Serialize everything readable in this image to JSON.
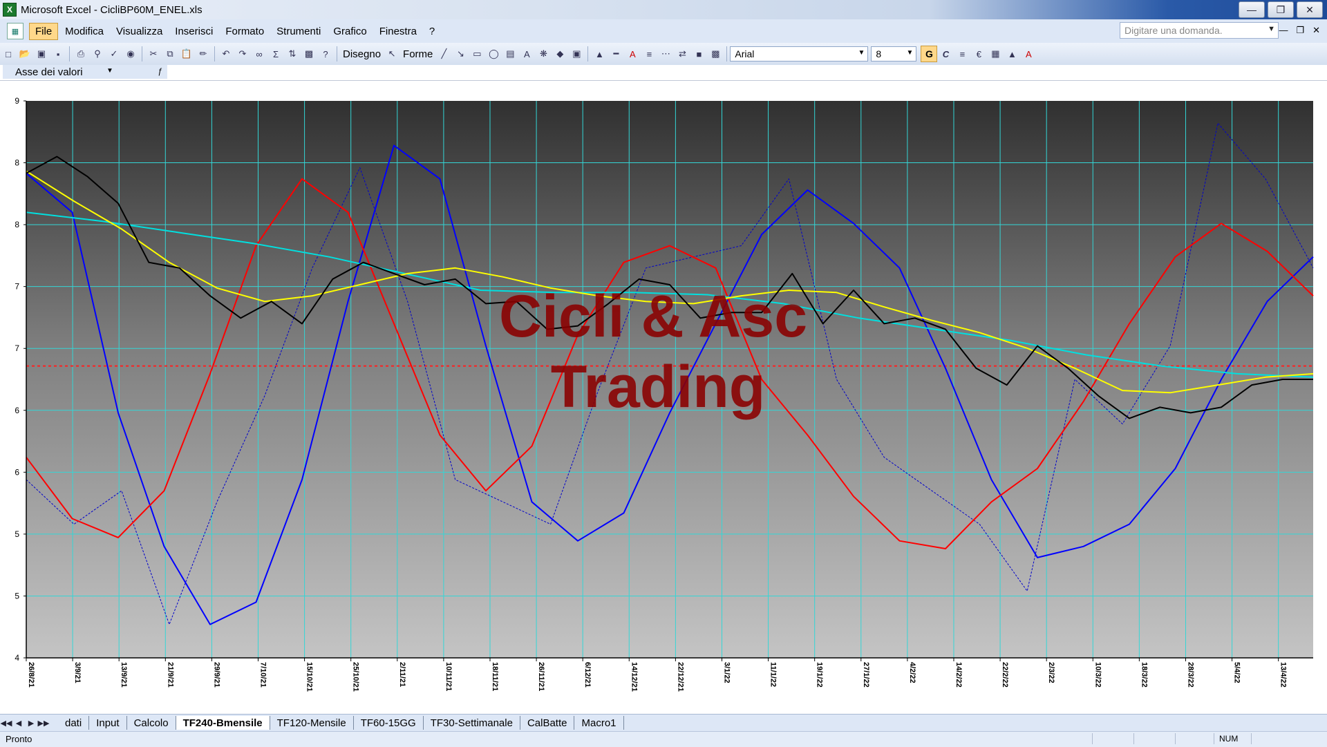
{
  "window": {
    "title": "Microsoft Excel - CicliBP60M_ENEL.xls"
  },
  "menu": [
    "File",
    "Modifica",
    "Visualizza",
    "Inserisci",
    "Formato",
    "Strumenti",
    "Grafico",
    "Finestra",
    "?"
  ],
  "ask_placeholder": "Digitare una domanda.",
  "toolbar": {
    "draw_label": "Disegno",
    "shapes_label": "Forme",
    "font": "Arial",
    "font_size": "8",
    "bold": "G",
    "italic": "C",
    "euro": "€"
  },
  "namebox": "Asse dei valori",
  "watermark": {
    "line1": "Cicli & Asc",
    "line2": "Trading"
  },
  "chart_data": {
    "type": "line",
    "y_tick_labels": [
      "9",
      "8",
      "8",
      "7",
      "7",
      "6",
      "6",
      "5",
      "5",
      "4"
    ],
    "x_tick_labels": [
      "26/8/21",
      "3/9/21",
      "13/9/21",
      "21/9/21",
      "29/9/21",
      "7/10/21",
      "15/10/21",
      "25/10/21",
      "2/11/21",
      "10/11/21",
      "18/11/21",
      "26/11/21",
      "6/12/21",
      "14/12/21",
      "22/12/21",
      "3/1/22",
      "11/1/22",
      "19/1/22",
      "27/1/22",
      "4/2/22",
      "14/2/22",
      "22/2/22",
      "2/3/22",
      "10/3/22",
      "18/3/22",
      "28/3/22",
      "5/4/22",
      "13/4/22"
    ],
    "ylim": [
      4,
      9
    ],
    "reference_line": 6.62,
    "series": [
      {
        "color": "#000000",
        "values": [
          8.35,
          8.5,
          8.32,
          8.08,
          7.55,
          7.5,
          7.25,
          7.05,
          7.2,
          7.0,
          7.4,
          7.55,
          7.45,
          7.35,
          7.4,
          7.18,
          7.2,
          6.95,
          6.98,
          7.18,
          7.4,
          7.35,
          7.05,
          7.1,
          7.1,
          7.45,
          7.0,
          7.3,
          7.0,
          7.05,
          6.95,
          6.6,
          6.45,
          6.8,
          6.6,
          6.35,
          6.15,
          6.25,
          6.2,
          6.25,
          6.45,
          6.5,
          6.5
        ]
      },
      {
        "color": "#ffff00",
        "values": [
          8.37,
          8.1,
          7.85,
          7.55,
          7.32,
          7.2,
          7.25,
          7.35,
          7.45,
          7.5,
          7.42,
          7.32,
          7.25,
          7.2,
          7.18,
          7.25,
          7.3,
          7.28,
          7.15,
          7.03,
          6.92,
          6.78,
          6.6,
          6.4,
          6.38,
          6.45,
          6.52,
          6.55
        ]
      },
      {
        "color": "#00e0e0",
        "values": [
          8.0,
          7.92,
          7.82,
          7.72,
          7.6,
          7.45,
          7.3,
          7.28,
          7.28,
          7.26,
          7.18,
          7.05,
          6.95,
          6.85,
          6.72,
          6.62,
          6.55,
          6.52
        ]
      },
      {
        "color": "#ff0000",
        "values": [
          5.8,
          5.25,
          5.08,
          5.5,
          6.55,
          7.7,
          8.3,
          8.0,
          7.0,
          6.0,
          5.5,
          5.9,
          6.9,
          7.55,
          7.7,
          7.5,
          6.5,
          6.0,
          5.45,
          5.05,
          4.98,
          5.4,
          5.7,
          6.3,
          7.0,
          7.6,
          7.9,
          7.65,
          7.25
        ]
      },
      {
        "color": "#0000ff",
        "values": [
          8.35,
          8.0,
          6.2,
          5.0,
          4.3,
          4.5,
          5.6,
          7.2,
          8.6,
          8.3,
          6.8,
          5.4,
          5.05,
          5.3,
          6.2,
          7.0,
          7.8,
          8.2,
          7.9,
          7.5,
          6.6,
          5.6,
          4.9,
          5.0,
          5.2,
          5.7,
          6.5,
          7.2,
          7.6
        ]
      },
      {
        "color": "#0000cc",
        "values": [
          5.6,
          5.2,
          5.5,
          4.3,
          5.4,
          6.35,
          7.5,
          8.4,
          7.2,
          5.6,
          5.4,
          5.2,
          6.4,
          7.5,
          7.6,
          7.7,
          8.3,
          6.5,
          5.8,
          5.5,
          5.2,
          4.6,
          6.5,
          6.1,
          6.8,
          8.8,
          8.3,
          7.5
        ]
      }
    ]
  },
  "sheet_tabs": [
    "dati",
    "Input",
    "Calcolo",
    "TF240-Bmensile",
    "TF120-Mensile",
    "TF60-15GG",
    "TF30-Settimanale",
    "CalBatte",
    "Macro1"
  ],
  "active_tab": "TF240-Bmensile",
  "status": {
    "text": "Pronto",
    "num": "NUM"
  }
}
